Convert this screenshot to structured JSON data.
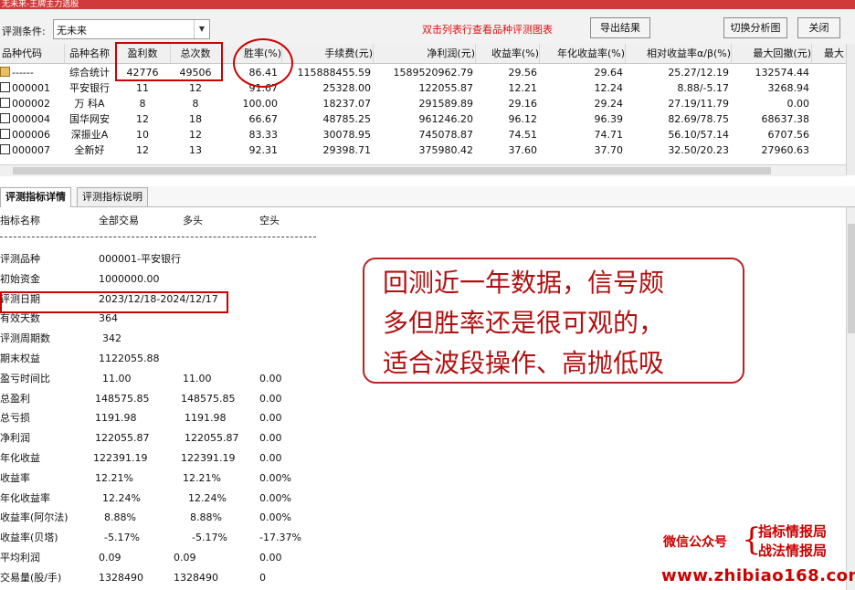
{
  "window": {
    "title": "无未来-王牌主力选股"
  },
  "toolbar": {
    "condition_label": "评测条件:",
    "condition_value": "无未来",
    "hint": "双击列表行查看品种评测图表",
    "export_label": "导出结果",
    "switch_chart_label": "切换分析图",
    "close_label": "关闭"
  },
  "table": {
    "columns": [
      "品种代码",
      "品种名称",
      "盈利数",
      "总次数",
      "胜率(%)",
      "手续费(元)",
      "净利润(元)",
      "收益率(%)",
      "年化收益率(%)",
      "相对收益率α/β(%)",
      "最大回撤(元)",
      "最大"
    ],
    "rows": [
      [
        "------",
        "综合统计",
        "42776",
        "49506",
        "86.41",
        "115888455.59",
        "1589520962.79",
        "29.56",
        "29.64",
        "25.27/12.19",
        "132574.44"
      ],
      [
        "000001",
        "平安银行",
        "11",
        "12",
        "91.67",
        "25328.00",
        "122055.87",
        "12.21",
        "12.24",
        "8.88/-5.17",
        "3268.94"
      ],
      [
        "000002",
        "万 科A",
        "8",
        "8",
        "100.00",
        "18237.07",
        "291589.89",
        "29.16",
        "29.24",
        "27.19/11.79",
        "0.00"
      ],
      [
        "000004",
        "国华网安",
        "12",
        "18",
        "66.67",
        "48785.25",
        "961246.20",
        "96.12",
        "96.39",
        "82.69/78.75",
        "68637.38"
      ],
      [
        "000006",
        "深振业A",
        "10",
        "12",
        "83.33",
        "30078.95",
        "745078.87",
        "74.51",
        "74.71",
        "56.10/57.14",
        "6707.56"
      ],
      [
        "000007",
        "全新好",
        "12",
        "13",
        "92.31",
        "29398.71",
        "375980.42",
        "37.60",
        "37.70",
        "32.50/20.23",
        "27960.63"
      ]
    ]
  },
  "tabs": [
    "评测指标详情",
    "评测指标说明"
  ],
  "detail": {
    "headers": [
      "指标名称",
      "全部交易",
      "多头",
      "空头"
    ],
    "rows": [
      [
        "评测品种",
        "000001-平安银行",
        "",
        ""
      ],
      [
        "初始资金",
        "1000000.00",
        "",
        ""
      ],
      [
        "评测日期",
        "2023/12/18-2024/12/17",
        "",
        ""
      ],
      [
        "有效天数",
        "364",
        "",
        ""
      ],
      [
        "评测周期数",
        "342",
        "",
        ""
      ],
      [
        "期末权益",
        "1122055.88",
        "",
        ""
      ],
      [
        "盈亏时间比",
        "11.00",
        "11.00",
        "0.00"
      ],
      [
        "总盈利",
        "148575.85",
        "148575.85",
        "0.00"
      ],
      [
        "总亏损",
        "1191.98",
        "1191.98",
        "0.00"
      ],
      [
        "净利润",
        "122055.87",
        "122055.87",
        "0.00"
      ],
      [
        "年化收益",
        "122391.19",
        "122391.19",
        "0.00"
      ],
      [
        "收益率",
        "12.21%",
        "12.21%",
        "0.00%"
      ],
      [
        "年化收益率",
        "12.24%",
        "12.24%",
        "0.00%"
      ],
      [
        "收益率(阿尔法)",
        "8.88%",
        "8.88%",
        "0.00%"
      ],
      [
        "收益率(贝塔)",
        "-5.17%",
        "-5.17%",
        "-17.37%"
      ],
      [
        "平均利润",
        "0.09",
        "0.09",
        "0.00"
      ],
      [
        "交易量(股/手)",
        "1328490",
        "1328490",
        "0"
      ]
    ]
  },
  "callout": {
    "lines": [
      "回测近一年数据，信号颇",
      "多但胜率还是很可观的，",
      "适合波段操作、高抛低吸"
    ]
  },
  "watermark": {
    "wechat_label": "微信公众号",
    "brand1": "指标情报局",
    "brand2": "战法情报局",
    "url": "www.zhibiao168.com"
  },
  "colors": {
    "accent_red": "#cc0000",
    "title_bar": "#d13a3a"
  }
}
